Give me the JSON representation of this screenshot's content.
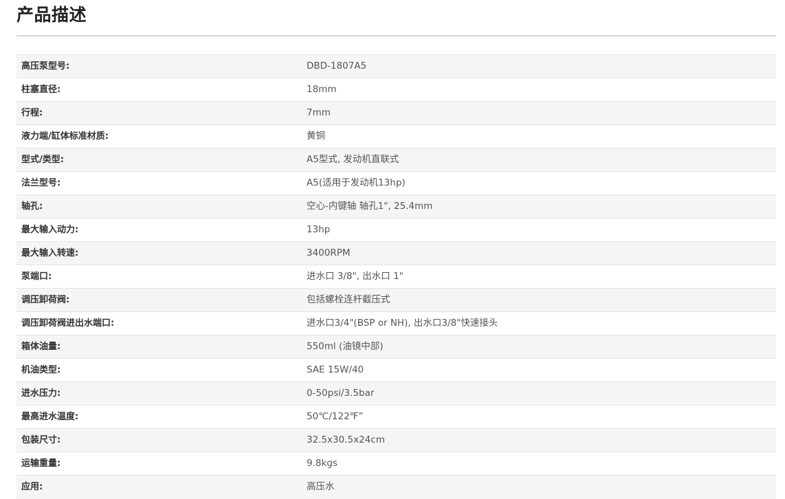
{
  "title": "产品描述",
  "specs": [
    {
      "label": "高压泵型号:",
      "value": "DBD-1807A5"
    },
    {
      "label": "柱塞直径:",
      "value": "18mm"
    },
    {
      "label": "行程:",
      "value": "7mm"
    },
    {
      "label": "液力端/缸体标准材质:",
      "value": "黄铜"
    },
    {
      "label": "型式/类型:",
      "value": "A5型式, 发动机直联式"
    },
    {
      "label": "法兰型号:",
      "value": "A5(适用于发动机13hp)"
    },
    {
      "label": "轴孔:",
      "value": "空心-内键轴  轴孔1\", 25.4mm"
    },
    {
      "label": "最大输入动力:",
      "value": "13hp"
    },
    {
      "label": "最大输入转速:",
      "value": "3400RPM"
    },
    {
      "label": "泵端口:",
      "value": "进水口 3/8\", 出水口 1\""
    },
    {
      "label": "调压卸荷阀:",
      "value": "包括螺栓连杆截压式"
    },
    {
      "label": "调压卸荷阀进出水端口:",
      "value": "进水口3/4\"(BSP or NH), 出水口3/8\"快速接头"
    },
    {
      "label": "箱体油量:",
      "value": "550ml (油镜中部)"
    },
    {
      "label": "机油类型:",
      "value": "SAE 15W/40"
    },
    {
      "label": "进水压力:",
      "value": "0-50psi/3.5bar"
    },
    {
      "label": "最高进水温度:",
      "value": "50℃/122℉”"
    },
    {
      "label": "包装尺寸:",
      "value": "32.5x30.5x24cm"
    },
    {
      "label": "运输重量:",
      "value": "9.8kgs"
    },
    {
      "label": "应用:",
      "value": "高压水"
    }
  ]
}
